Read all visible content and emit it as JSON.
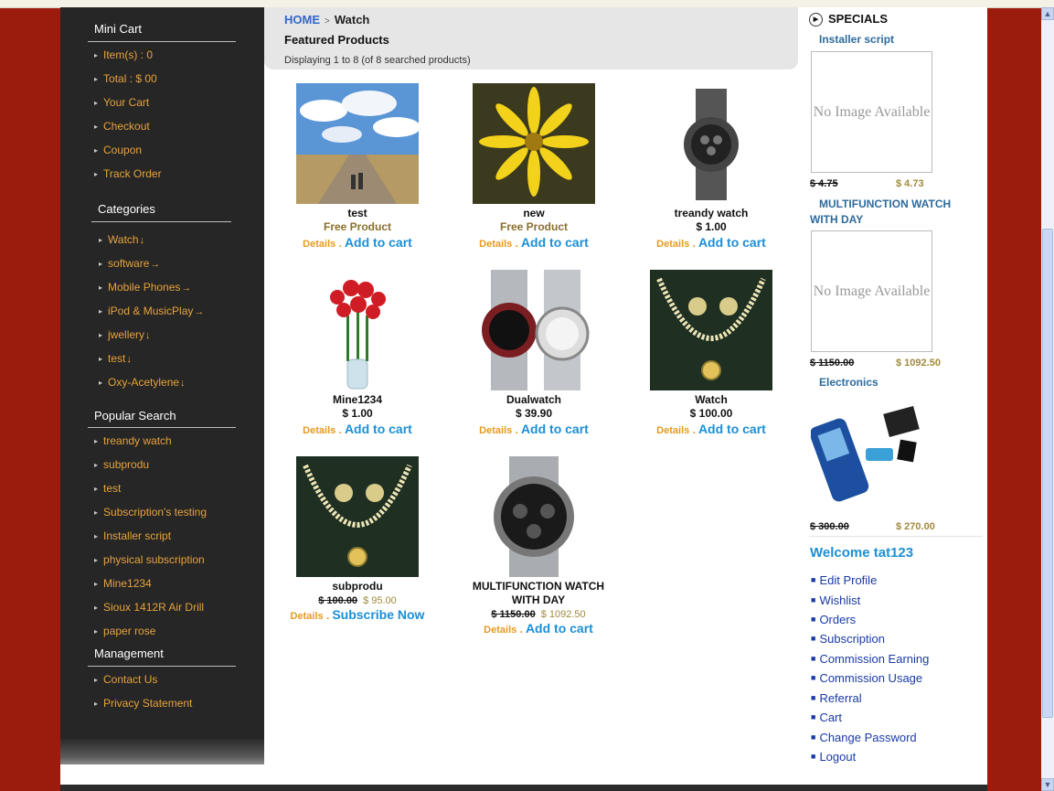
{
  "mini_cart": {
    "heading": "Mini Cart",
    "items": [
      "Item(s) : 0",
      "Total : $ 00",
      "Your Cart",
      "Checkout",
      "Coupon",
      "Track Order"
    ]
  },
  "categories": {
    "heading": "Categories",
    "items": [
      {
        "label": "Watch",
        "mark": "↓"
      },
      {
        "label": "software",
        "mark": "→"
      },
      {
        "label": "Mobile Phones",
        "mark": "→"
      },
      {
        "label": "iPod & MusicPlay",
        "mark": "→"
      },
      {
        "label": "jwellery",
        "mark": "↓"
      },
      {
        "label": "test",
        "mark": "↓"
      },
      {
        "label": "Oxy-Acetylene",
        "mark": "↓"
      }
    ]
  },
  "popular_search": {
    "heading": "Popular Search",
    "items": [
      "treandy watch",
      "subprodu",
      "test",
      "Subscription's testing",
      "Installer script",
      "physical subscription",
      "Mine1234",
      "Sioux 1412R Air Drill",
      "paper rose"
    ]
  },
  "management": {
    "heading": "Management",
    "items": [
      "Contact Us",
      "Privacy Statement"
    ]
  },
  "breadcrumb": {
    "home": "HOME",
    "separator": ">",
    "current": "Watch"
  },
  "featured_title": "Featured Products",
  "displaying": "Displaying 1 to 8 (of 8 searched products)",
  "products": [
    {
      "name": "test",
      "price_label": "Free Product",
      "details": "Details",
      "sep": ".",
      "action": "Add to cart"
    },
    {
      "name": "new",
      "price_label": "Free Product",
      "details": "Details",
      "sep": ".",
      "action": "Add to cart"
    },
    {
      "name": "treandy watch",
      "price": "$ 1.00",
      "details": "Details",
      "sep": ".",
      "action": "Add to cart"
    },
    {
      "name": "Mine1234",
      "price": "$ 1.00",
      "details": "Details",
      "sep": ".",
      "action": "Add to cart"
    },
    {
      "name": "Dualwatch",
      "price": "$ 39.90",
      "details": "Details",
      "sep": ".",
      "action": "Add to cart"
    },
    {
      "name": "Watch",
      "price": "$ 100.00",
      "details": "Details",
      "sep": ".",
      "action": "Add to cart"
    },
    {
      "name": "subprodu",
      "old_price": "$ 100.00",
      "new_price": "$ 95.00",
      "details": "Details",
      "sep": ".",
      "action": "Subscribe Now"
    },
    {
      "name": "MULTIFUNCTION WATCH WITH DAY",
      "old_price": "$ 1150.00",
      "new_price": "$ 1092.50",
      "details": "Details",
      "sep": ".",
      "action": "Add to cart"
    }
  ],
  "specials": {
    "heading": "SPECIALS",
    "items": [
      {
        "name": "Installer script",
        "image_text": "No Image Available",
        "old_price": "$ 4.75",
        "new_price": "$ 4.73"
      },
      {
        "name": "MULTIFUNCTION WATCH WITH DAY",
        "image_text": "No Image Available",
        "old_price": "$ 1150.00",
        "new_price": "$ 1092.50"
      },
      {
        "name": "Electronics",
        "old_price": "$ 300.00",
        "new_price": "$ 270.00"
      }
    ]
  },
  "account": {
    "welcome": "Welcome tat123",
    "links": [
      "Edit Profile",
      "Wishlist",
      "Orders",
      "Subscription",
      "Commission Earning",
      "Commission Usage",
      "Referral",
      "Cart",
      "Change Password",
      "Logout"
    ]
  },
  "colors": {
    "background": "#9b1c0c",
    "sidebar": "#262626",
    "link_orange": "#e6a23c",
    "cart_blue": "#1b8fd6"
  }
}
